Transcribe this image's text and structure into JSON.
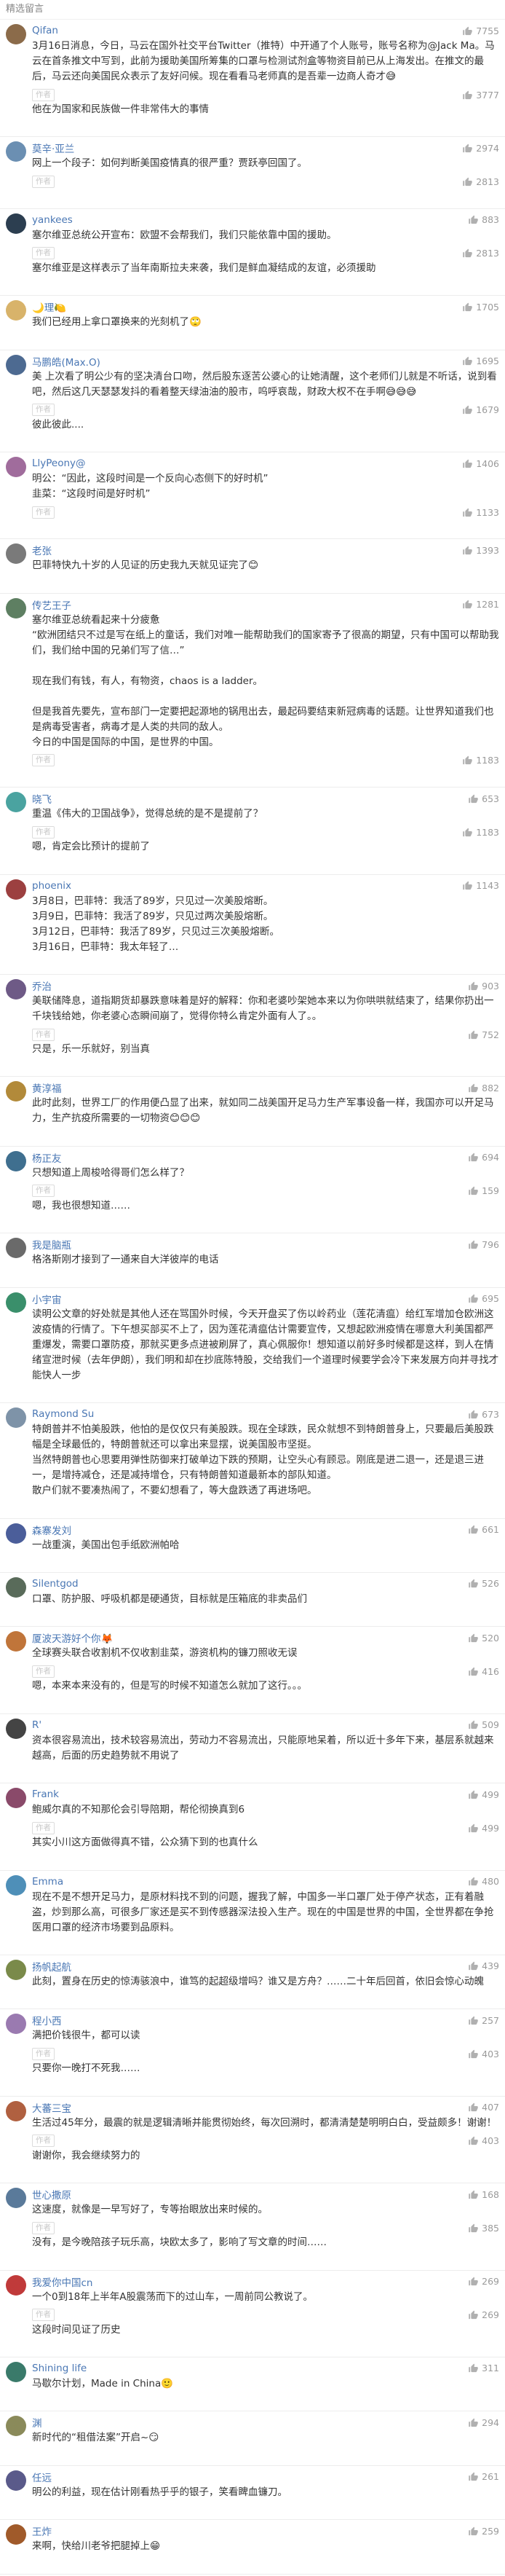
{
  "header": {
    "title": "精选留言"
  },
  "thumb_color": "#b0b0b0",
  "comments": [
    {
      "name": "Qifan",
      "likes": "7755",
      "color": "#8b6b4a",
      "text": "3月16日消息，今日，马云在国外社交平台Twitter（推特）中开通了个人账号，账号名称为@Jack Ma。马云在首条推文中写到，此前为援助美国所筹集的口罩与检测试剂盒等物资目前已从上海发出。在推文的最后，马云还向美国民众表示了友好问候。现在看看马老师真的是吾辈一边商人奇才😅",
      "reply_badge": "作者",
      "reply_likes": "3777",
      "reply": "他在为国家和民族做一件非常伟大的事情"
    },
    {
      "name": "莫辛·亚兰",
      "likes": "2974",
      "color": "#6b8fb2",
      "text": "网上一个段子：如何判断美国疫情真的很严重？贾跃亭回国了。",
      "reply_badge": "作者",
      "reply_likes": "2813",
      "reply": ""
    },
    {
      "name": "yankees",
      "likes": "883",
      "color": "#2c3e50",
      "text": "塞尔维亚总统公开宣布：欧盟不会帮我们，我们只能依靠中国的援助。",
      "reply_badge": "作者",
      "reply_likes": "2813",
      "reply": "塞尔维亚是这样表示了当年南斯拉夫来袭，我们是鲜血凝结成的友谊，必须援助"
    },
    {
      "name": "🌙理🍋",
      "likes": "1705",
      "color": "#d8b36a",
      "text": "我们已经用上拿口罩换来的光刻机了🙄",
      "reply_badge": "",
      "reply_likes": "",
      "reply": ""
    },
    {
      "name": "马鹏皓(Max.O)",
      "likes": "1695",
      "color": "#4d6a91",
      "text": "美 上次看了明公少有的坚决清台口吻，然后股东逐苦公婆心的让她清醒，这个老师们儿就是不听话，说到看吧，然后这几天瑟瑟发抖的看着整天绿油油的股市，呜呼哀哉，财政大权不在手啊😅😅😅",
      "reply_badge": "作者",
      "reply_likes": "1679",
      "reply": "彼此彼此...."
    },
    {
      "name": "LlyPeony@",
      "likes": "1406",
      "color": "#a06c9c",
      "text": "明公：“因此，这段时间是一个反向心态侧下的好时机”\n韭菜：“这段时间是好时机”",
      "reply_badge": "作者",
      "reply_likes": "1133",
      "reply": ""
    },
    {
      "name": "老张",
      "likes": "1393",
      "color": "#7a7a7a",
      "text": "巴菲特快九十岁的人见证的历史我九天就见证完了😊",
      "reply_badge": "",
      "reply_likes": "",
      "reply": ""
    },
    {
      "name": "传艺王子",
      "likes": "1281",
      "color": "#5e7f62",
      "text": "塞尔维亚总统看起来十分疲惫\n“欧洲团结只不过是写在纸上的童话，我们对唯一能帮助我们的国家寄予了很高的期望，只有中国可以帮助我们，我们给中国的兄弟们写了信…”\n\n现在我们有钱，有人，有物资，chaos is a ladder。\n\n但是我首先要先，宣布部门一定要把起源地的锅甩出去，最起码要结束新冠病毒的话题。让世界知道我们也是病毒受害者，病毒才是人类的共同的敌人。\n今日的中国是国际的中国，是世界的中国。",
      "reply_badge": "作者",
      "reply_likes": "1183",
      "reply": ""
    },
    {
      "name": "晓飞",
      "likes": "653",
      "color": "#4aa3a0",
      "text": "重温《伟大的卫国战争》，觉得总统的是不是提前了？",
      "reply_badge": "作者",
      "reply_likes": "1183",
      "reply": "嗯，肯定会比预计的提前了"
    },
    {
      "name": "phoenix",
      "likes": "1143",
      "color": "#9c4040",
      "text": "3月8日，巴菲特：我活了89岁，只见过一次美股熔断。\n3月9日，巴菲特：我活了89岁，只见过两次美股熔断。\n3月12日，巴菲特：我活了89岁，只见过三次美股熔断。\n3月16日，巴菲特：我太年轻了…",
      "reply_badge": "",
      "reply_likes": "",
      "reply": ""
    },
    {
      "name": "乔治",
      "likes": "903",
      "color": "#6e5a86",
      "text": "美联储降息，道指期货却暴跌意味着是好的解释：你和老婆吵架她本来以为你哄哄就结束了，结果你扔出一千块钱给她，你老婆心态瞬间崩了，觉得你特么肯定外面有人了。。",
      "reply_badge": "作者",
      "reply_likes": "752",
      "reply": "只是，乐一乐就好，别当真"
    },
    {
      "name": "黄淳福",
      "likes": "882",
      "color": "#b28a3a",
      "text": "此时此刻，世界工厂的作用便凸显了出来，就如同二战美国开足马力生产军事设备一样，我国亦可以开足马力，生产抗疫所需要的一切物资😊😊😊",
      "reply_badge": "",
      "reply_likes": "",
      "reply": ""
    },
    {
      "name": "杨正友",
      "likes": "694",
      "color": "#3f6f8f",
      "text": "只想知道上周梭哈得哥们怎么样了？",
      "reply_badge": "作者",
      "reply_likes": "159",
      "reply": "嗯，我也很想知道……"
    },
    {
      "name": "我是脑瓶",
      "likes": "796",
      "color": "#6a6a6a",
      "text": "格洛斯刚才接到了一通来自大洋彼岸的电话",
      "reply_badge": "",
      "reply_likes": "",
      "reply": ""
    },
    {
      "name": "小宇宙",
      "likes": "695",
      "color": "#3a8f6b",
      "text": "读明公文章的好处就是其他人还在骂国外时候，今天开盘买了伤以岭药业（莲花清瘟）给红军增加仓欧洲这波疫情的行情了。下午想买部买不上了，因为莲花清瘟估计需要宣传，又想起欧洲疫情在哪意大利美国都严重爆发，需要口罩防疫，那就买更多点进被刷屏了，真心佩服你！想知道以前好多时候都是这样，到人在情绪宣泄时候（去年伊朗），我们明和却在抄底陈特股，交给我们一个道理时候要学会冷下来发展方向并寻找才能快人一步",
      "reply_badge": "",
      "reply_likes": "",
      "reply": ""
    },
    {
      "name": "Raymond Su",
      "likes": "673",
      "color": "#7e93a8",
      "text": "特朗普并不怕美股跌，他怕的是仅仅只有美股跌。现在全球跌，民众就想不到特朗普身上，只要最后美股跌幅是全球最低的，特朗普就还可以拿出来显摆，说美国股市坚挺。\n当然特朗普也心思要用弹性防御来打破单边下跌的预期，让空头心有顾忌。刚底是进二退一，还是退三进一，是增持减仓，还是减持增仓，只有特朗普知道最新本的部队知道。\n散户们就不要凑热闹了，不要幻想看了，等大盘跌透了再进场吧。",
      "reply_badge": "",
      "reply_likes": "",
      "reply": ""
    },
    {
      "name": "森寨发刘",
      "likes": "661",
      "color": "#4b5e9a",
      "text": "一战重演，美国出包手纸欧洲帕哈",
      "reply_badge": "",
      "reply_likes": "",
      "reply": ""
    },
    {
      "name": "Silentgod",
      "likes": "526",
      "color": "#596b5a",
      "text": "口罩、防护服、呼吸机都是硬通货，目标就是压箱底的非卖品们",
      "reply_badge": "",
      "reply_likes": "",
      "reply": ""
    },
    {
      "name": "厦波天游好个你🦊",
      "likes": "520",
      "color": "#c0753a",
      "text": "全球赛头联合收割机不仅收割韭菜，游资机构的镰刀照收无误",
      "reply_badge": "作者",
      "reply_likes": "416",
      "reply": "嗯，本来本来没有的，但是写的时候不知道怎么就加了这行。。。"
    },
    {
      "name": "R'",
      "likes": "509",
      "color": "#444",
      "text": "资本很容易流出，技术较容易流出，劳动力不容易流出，只能原地呆着，所以近十多年下来，基层系就越来越高，后面的历史趋势就不用说了",
      "reply_badge": "",
      "reply_likes": "",
      "reply": ""
    },
    {
      "name": "Frank",
      "likes": "499",
      "color": "#8a4a6a",
      "text": "鲍威尔真的不知那伦会引导陪期，帮伦彻换真到6",
      "reply_badge": "作者",
      "reply_likes": "499",
      "reply": "其实小川这方面做得真不错，公众猜下到的也真什么"
    },
    {
      "name": "Emma",
      "likes": "480",
      "color": "#4e8fb8",
      "text": "现在不是不想开足马力，是原材料找不到的问题，握我了解，中国多一半口罩厂处于停产状态，正有着融盗，炒到那么高，可很多厂家还是买不到传感器深法投入生产。现在的中国是世界的中国，全世界都在争抢医用口罩的经济市场要到品原料。",
      "reply_badge": "",
      "reply_likes": "",
      "reply": ""
    },
    {
      "name": "扬帆起航",
      "likes": "439",
      "color": "#7a8a4a",
      "text": "此刻，置身在历史的惊涛骇浪中，谁笃的起超级增吗？谁又是方舟？……二十年后回首，依旧会惊心动魄",
      "reply_badge": "",
      "reply_likes": "",
      "reply": ""
    },
    {
      "name": "程小西",
      "likes": "257",
      "color": "#9a7ab0",
      "text": "满把价钱很牛，都可以读",
      "reply_badge": "作者",
      "reply_likes": "403",
      "reply": "只要你一晚打不死我……"
    },
    {
      "name": "大蕃三宝",
      "likes": "407",
      "color": "#b06040",
      "text": "生活过45年分，最震的就是逻辑清晰并能贯彻始终，每次回溯时，都清清楚楚明明白白，受益颇多！谢谢！",
      "reply_badge": "作者",
      "reply_likes": "403",
      "reply": "谢谢你，我会继续努力的"
    },
    {
      "name": "世心撒原",
      "likes": "168",
      "color": "#5a7a9a",
      "text": "这速度，就像是一早写好了，专等抬眼放出来时候的。",
      "reply_badge": "作者",
      "reply_likes": "385",
      "reply": "没有，是今晚陪孩子玩乐高，块欧太多了，影响了写文章的时间……"
    },
    {
      "name": "我爱你中国cn",
      "likes": "269",
      "color": "#c03a3a",
      "text": "一个0到18年上半年A股震荡而下的过山车，一周前同公教说了。",
      "reply_badge": "作者",
      "reply_likes": "269",
      "reply": "这段时间见证了历史"
    },
    {
      "name": "Shining life",
      "likes": "311",
      "color": "#3a7a6a",
      "text": "马歇尔计划，Made in China🙂",
      "reply_badge": "",
      "reply_likes": "",
      "reply": ""
    },
    {
      "name": "渊",
      "likes": "294",
      "color": "#8a8a5a",
      "text": "新时代的“租借法案”开启~😏",
      "reply_badge": "",
      "reply_likes": "",
      "reply": ""
    },
    {
      "name": "任远",
      "likes": "261",
      "color": "#5a5a8a",
      "text": "明公的利益，现在估计刚看热乎乎的银子，笑看睥血镰刀。",
      "reply_badge": "",
      "reply_likes": "",
      "reply": ""
    },
    {
      "name": "王炸",
      "likes": "259",
      "color": "#a05a2a",
      "text": "来啊，快给川老爷把腿掉上😁",
      "reply_badge": "",
      "reply_likes": "",
      "reply": ""
    }
  ]
}
